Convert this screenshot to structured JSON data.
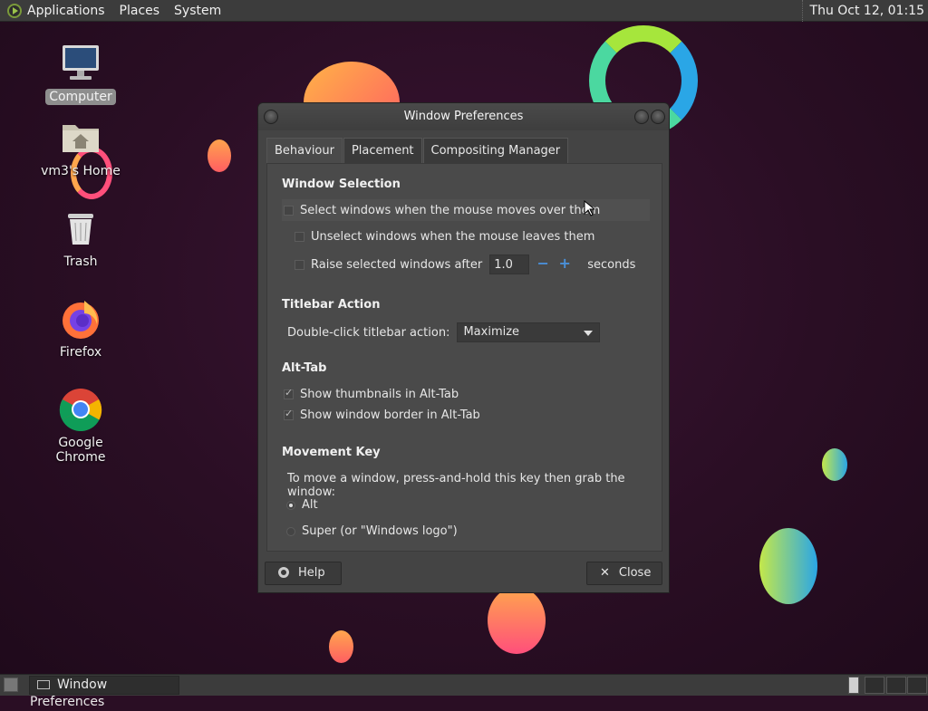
{
  "top_panel": {
    "menus": [
      "Applications",
      "Places",
      "System"
    ],
    "clock": "Thu Oct 12, 01:15"
  },
  "desktop_icons": [
    {
      "label": "Computer",
      "icon": "computer-icon"
    },
    {
      "label": "vm3's Home",
      "icon": "home-folder-icon"
    },
    {
      "label": "Trash",
      "icon": "trash-icon"
    },
    {
      "label": "Firefox",
      "icon": "firefox-icon"
    },
    {
      "label": "Google Chrome",
      "icon": "chrome-icon"
    }
  ],
  "window": {
    "title": "Window Preferences",
    "tabs": [
      "Behaviour",
      "Placement",
      "Compositing Manager"
    ],
    "active_tab": "Behaviour",
    "window_selection": {
      "heading": "Window Selection",
      "select_on_hover": {
        "label": "Select windows when the mouse moves over them",
        "checked": false
      },
      "unselect_on_leave": {
        "label": "Unselect windows when the mouse leaves them",
        "checked": false
      },
      "raise_after": {
        "label": "Raise selected windows after",
        "value": "1.0",
        "unit": "seconds",
        "checked": false
      }
    },
    "titlebar_action": {
      "heading": "Titlebar Action",
      "label": "Double-click titlebar action:",
      "value": "Maximize"
    },
    "alt_tab": {
      "heading": "Alt-Tab",
      "show_thumbnails": {
        "label": "Show thumbnails in Alt-Tab",
        "checked": true
      },
      "show_border": {
        "label": "Show window border in Alt-Tab",
        "checked": true
      }
    },
    "movement_key": {
      "heading": "Movement Key",
      "description": "To move a window, press-and-hold this key then grab the window:",
      "options": [
        "Alt",
        "Super (or \"Windows logo\")"
      ],
      "selected": "Alt"
    },
    "help_label": "Help",
    "close_label": "Close"
  },
  "taskbar": {
    "task": "Window Preferences"
  }
}
